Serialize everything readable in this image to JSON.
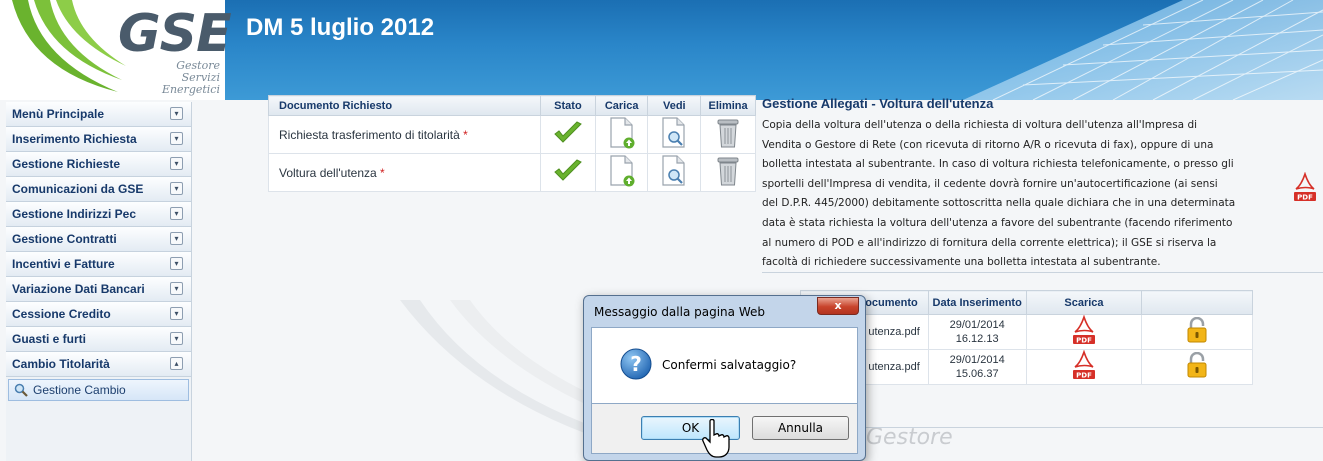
{
  "header": {
    "title": "DM 5 luglio 2012",
    "logo_text": "GSE",
    "logo_sub": [
      "Gestore",
      "Servizi",
      "Energetici"
    ]
  },
  "sidebar": {
    "items": [
      {
        "label": "Menù Principale",
        "toggle": "▾"
      },
      {
        "label": "Inserimento Richiesta",
        "toggle": "▾"
      },
      {
        "label": "Gestione Richieste",
        "toggle": "▾"
      },
      {
        "label": "Comunicazioni da GSE",
        "toggle": "▾"
      },
      {
        "label": "Gestione Indirizzi Pec",
        "toggle": "▾"
      },
      {
        "label": "Gestione Contratti",
        "toggle": "▾"
      },
      {
        "label": "Incentivi e Fatture",
        "toggle": "▾"
      },
      {
        "label": "Variazione Dati Bancari",
        "toggle": "▾"
      },
      {
        "label": "Cessione Credito",
        "toggle": "▾"
      },
      {
        "label": "Guasti e furti",
        "toggle": "▾"
      },
      {
        "label": "Cambio Titolarità",
        "toggle": "▴"
      }
    ],
    "sub_item": "Gestione Cambio"
  },
  "documents": {
    "headers": [
      "Documento Richiesto",
      "Stato",
      "Carica",
      "Vedi",
      "Elimina"
    ],
    "rows": [
      {
        "name": "Richiesta trasferimento di titolarità",
        "required": "*"
      },
      {
        "name": "Voltura dell'utenza",
        "required": "*"
      }
    ]
  },
  "info": {
    "title": "Gestione Allegati - Voltura dell'utenza",
    "lines": [
      "Copia della voltura dell'utenza o della richiesta di voltura dell'utenza all'Impresa di",
      "Vendita o Gestore di Rete (con ricevuta di ritorno A/R o ricevuta di fax), oppure di una",
      "bolletta intestata al subentrante. In caso di voltura richiesta telefonicamente, o presso gli",
      "sportelli dell'Impresa di vendita, il cedente dovrà fornire un'autocertificazione (ai sensi",
      "del D.P.R. 445/2000) debitamente sottoscritta nella quale dichiara che in una determinata",
      "data è stata richiesta la voltura dell'utenza a favore del subentrante (facendo riferimento",
      "al numero di POD e all'indirizzo di fornitura della corrente elettrica); il GSE si riserva la",
      "facoltà di richiedere successivamente una bolletta intestata al subentrante."
    ],
    "pdf_label": "PDF"
  },
  "attachments": {
    "headers": [
      "ocumento",
      "Data Inserimento",
      "Scarica",
      ""
    ],
    "rows": [
      {
        "file": "utenza.pdf",
        "date": "29/01/2014",
        "time": "16.12.13",
        "pdf_label": "PDF"
      },
      {
        "file": "utenza.pdf",
        "date": "29/01/2014",
        "time": "15.06.37",
        "pdf_label": "PDF"
      }
    ]
  },
  "watermark": "Gestore",
  "dialog": {
    "title": "Messaggio dalla pagina Web",
    "close": "x",
    "message": "Confermi salvataggio?",
    "ok": "OK",
    "cancel": "Annulla"
  },
  "colors": {
    "header_blue": "#2a86c9",
    "nav_text": "#17396a",
    "required": "#d02020",
    "check_green": "#6ab32e"
  }
}
